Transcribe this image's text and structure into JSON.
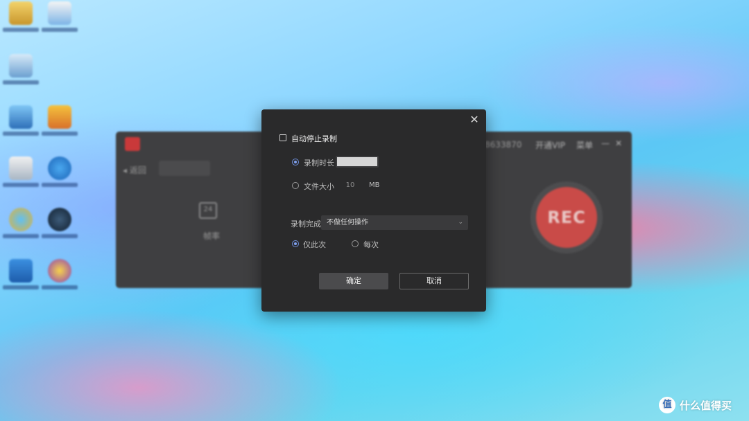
{
  "app": {
    "title": "",
    "back_label": "◂ 返回",
    "mode_label": "",
    "fps_value": "24",
    "fps_label": "帧率",
    "list_label": "",
    "autostop_label": "",
    "account_text": "8633870",
    "vip_label": "开通VIP",
    "menu_label": "菜单",
    "min_glyph": "—",
    "close_glyph": "✕",
    "rec_label": "REC"
  },
  "dialog": {
    "close_glyph": "✕",
    "auto_stop": {
      "label": "自动停止录制",
      "checked": false
    },
    "duration": {
      "label": "录制时长",
      "selected": true,
      "value": ""
    },
    "file_size": {
      "label": "文件大小",
      "selected": false,
      "value": "10",
      "unit": "MB"
    },
    "on_complete": {
      "label": "录制完成",
      "selected_option": "不做任何操作",
      "caret": "⌄"
    },
    "frequency": {
      "once_label": "仅此次",
      "once_selected": true,
      "every_label": "每次",
      "every_selected": false
    },
    "ok_label": "确定",
    "cancel_label": "取消"
  },
  "watermark": {
    "logo_glyph": "值",
    "text": "什么值得买"
  },
  "colors": {
    "rec_red": "#c94b48",
    "dialog_bg": "#2a2a2b",
    "radio_accent": "#7fa0ef"
  }
}
